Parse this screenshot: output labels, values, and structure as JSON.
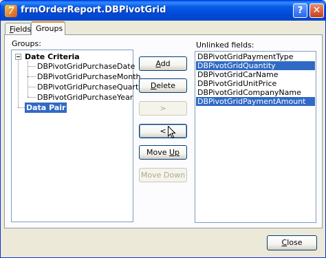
{
  "window": {
    "title": "frmOrderReport.DBPivotGrid",
    "app_icon_glyph": "7",
    "help_label": "?",
    "close_label": "✕"
  },
  "tabs": [
    {
      "label": "Fields",
      "access_key_index": 0,
      "selected": false
    },
    {
      "label": "Groups",
      "selected": true
    }
  ],
  "groups": {
    "label": "Groups:",
    "tree": [
      {
        "label": "Date Criteria",
        "bold": true,
        "expanded": true,
        "children": [
          "DBPivotGridPurchaseDate",
          "DBPivotGridPurchaseMonth",
          "DBPivotGridPurchaseQuarter",
          "DBPivotGridPurchaseYear"
        ]
      },
      {
        "label": "Data Pair",
        "bold": true,
        "selected": true
      }
    ]
  },
  "unlinked": {
    "label": "Unlinked fields:",
    "items": [
      {
        "label": "DBPivotGridPaymentType",
        "selected": false
      },
      {
        "label": "DBPivotGridQuantity",
        "selected": true
      },
      {
        "label": "DBPivotGridCarName",
        "selected": false
      },
      {
        "label": "DBPivotGridUnitPrice",
        "selected": false
      },
      {
        "label": "DBPivotGridCompanyName",
        "selected": false
      },
      {
        "label": "DBPivotGridPaymentAmount",
        "selected": true
      }
    ]
  },
  "buttons": {
    "add": {
      "label": "Add",
      "enabled": true
    },
    "delete": {
      "label": "Delete",
      "enabled": true
    },
    "move_right": {
      "label": ">",
      "enabled": false
    },
    "move_left": {
      "label": "<",
      "enabled": true
    },
    "move_up": {
      "label": "Move Up",
      "enabled": true
    },
    "move_down": {
      "label": "Move Down",
      "enabled": false
    },
    "close": {
      "label": "Close",
      "enabled": true
    }
  },
  "colors": {
    "title_bar": "#0049d6",
    "selection": "#316ac5",
    "dialog_face": "#ece9d8",
    "tab_highlight": "#e68b2c"
  }
}
